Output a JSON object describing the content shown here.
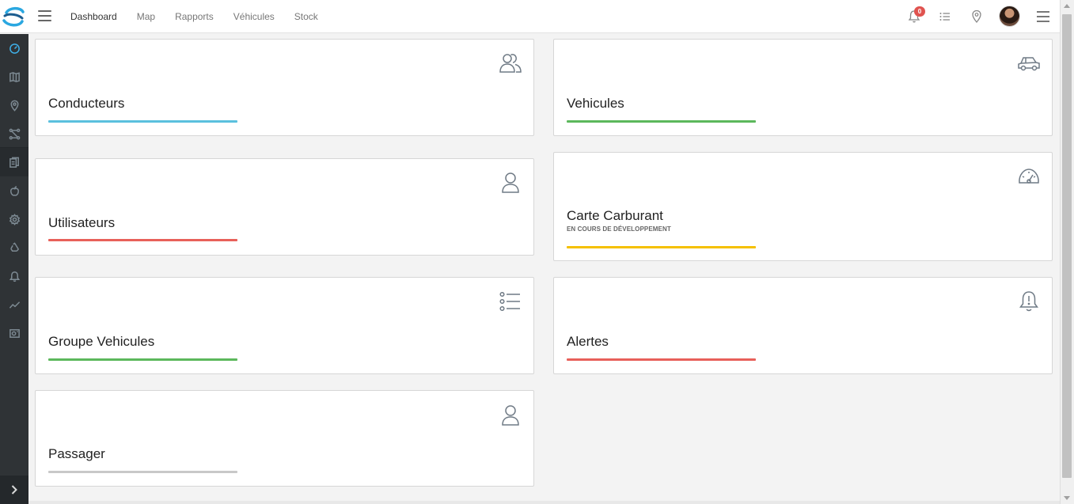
{
  "topnav": {
    "items": [
      "Dashboard",
      "Map",
      "Rapports",
      "Véhicules",
      "Stock"
    ]
  },
  "header": {
    "notifications_count": "0"
  },
  "cards": [
    {
      "title": "Conducteurs",
      "icon": "users-icon",
      "bar_color": "#5bc0de"
    },
    {
      "title": "Vehicules",
      "icon": "car-icon",
      "bar_color": "#5cb85c"
    },
    {
      "title": "Utilisateurs",
      "icon": "user-icon",
      "bar_color": "#e8605a"
    },
    {
      "title": "Carte Carburant",
      "subtitle": "EN COURS DE DÉVELOPPEMENT",
      "icon": "gauge-icon",
      "bar_color": "#f5c000"
    },
    {
      "title": "Groupe Vehicules",
      "icon": "list-icon",
      "bar_color": "#5cb85c"
    },
    {
      "title": "Alertes",
      "icon": "bell-alert-icon",
      "bar_color": "#e8605a"
    },
    {
      "title": "Passager",
      "icon": "user-icon",
      "bar_color": "#c8c8c8"
    }
  ],
  "sidebar": {
    "items": [
      "dashboard-icon",
      "map-icon",
      "location-icon",
      "routes-icon",
      "documents-icon",
      "apple-icon",
      "settings-icon",
      "recycle-icon",
      "bell-icon",
      "chart-icon",
      "camera-icon"
    ]
  },
  "colors": {
    "accent": "#3fb0e8",
    "sidebar_bg": "#2f3336",
    "badge": "#e0534f"
  }
}
